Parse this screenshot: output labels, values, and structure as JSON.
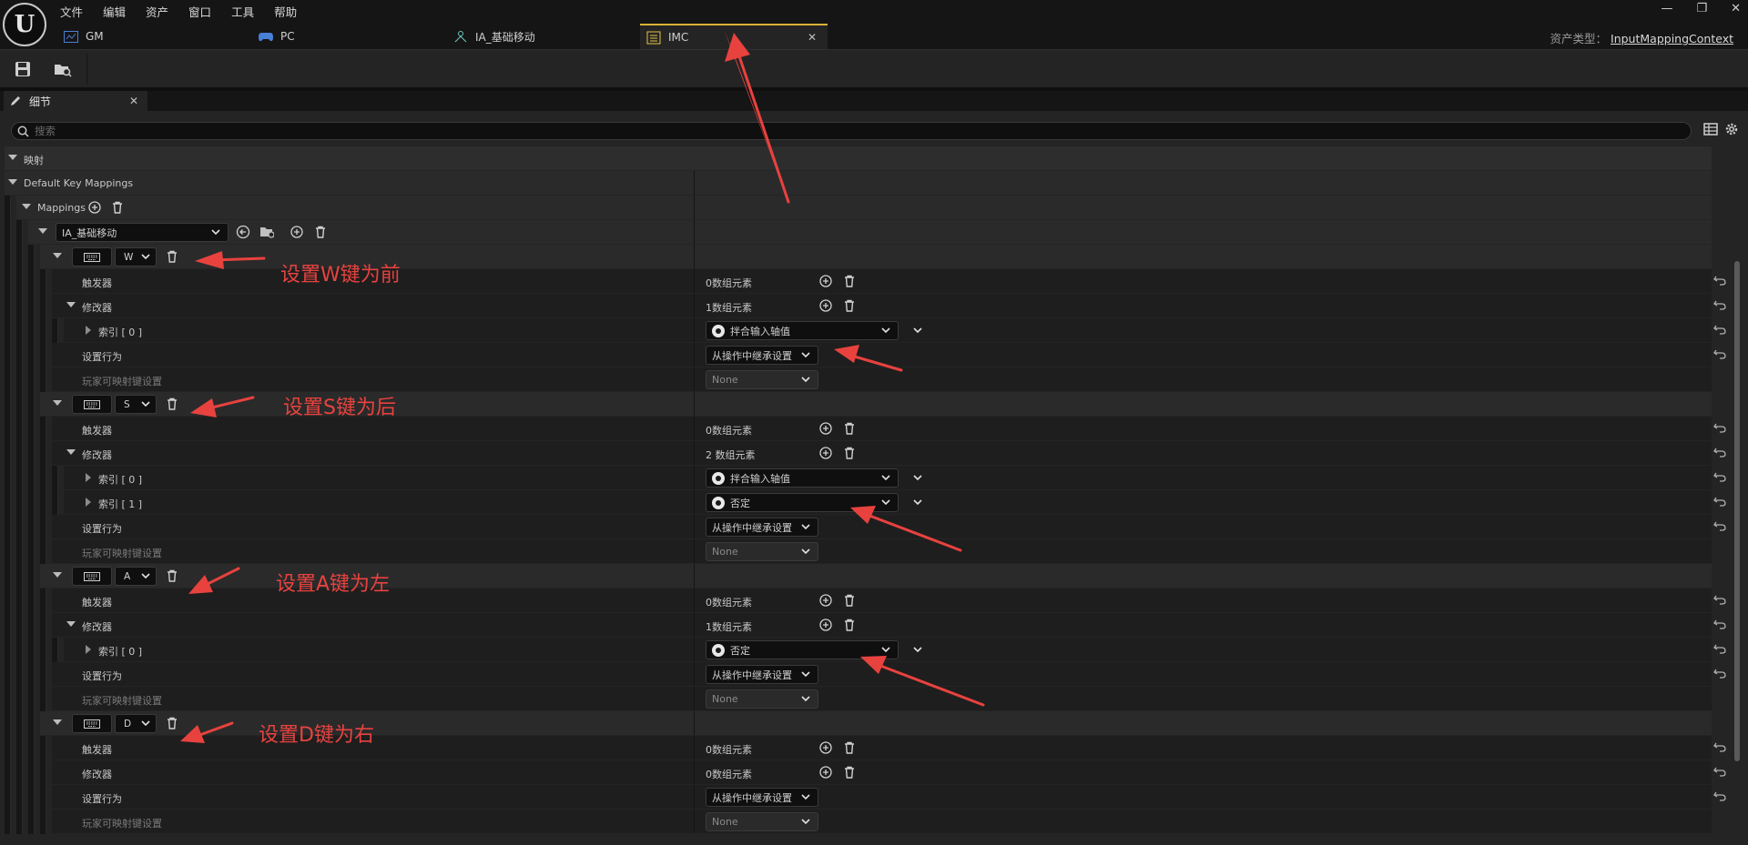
{
  "menu": [
    "文件",
    "编辑",
    "资产",
    "窗口",
    "工具",
    "帮助"
  ],
  "tabs": [
    {
      "label": "GM",
      "icon": "blueprint-icon"
    },
    {
      "label": "PC",
      "icon": "gamepad-icon"
    },
    {
      "label": "IA_基础移动",
      "icon": "input-action-icon"
    },
    {
      "label": "IMC",
      "icon": "input-mapping-context-icon",
      "active": true
    }
  ],
  "asset_type": {
    "label": "资产类型：",
    "value": "InputMappingContext"
  },
  "details": {
    "tab_label": "细节",
    "search_placeholder": "搜索"
  },
  "sections": {
    "mapping_category": "映射",
    "default_key_mappings": "Default Key Mappings",
    "mappings": "Mappings",
    "input_action": "IA_基础移动"
  },
  "keys": [
    {
      "key": "W",
      "trigger_label": "触发器",
      "trigger_value": "0数组元素",
      "modifier_label": "修改器",
      "modifier_value": "1数组元素",
      "modifiers": [
        {
          "index": "索引 [ 0 ]",
          "name": "拌合输入轴值"
        }
      ],
      "behavior_label": "设置行为",
      "behavior_value": "从操作中继承设置",
      "player_label": "玩家可映射键设置",
      "player_value": "None"
    },
    {
      "key": "S",
      "trigger_label": "触发器",
      "trigger_value": "0数组元素",
      "modifier_label": "修改器",
      "modifier_value": "2 数组元素",
      "modifiers": [
        {
          "index": "索引 [ 0 ]",
          "name": "拌合输入轴值"
        },
        {
          "index": "索引 [ 1 ]",
          "name": "否定"
        }
      ],
      "behavior_label": "设置行为",
      "behavior_value": "从操作中继承设置",
      "player_label": "玩家可映射键设置",
      "player_value": "None"
    },
    {
      "key": "A",
      "trigger_label": "触发器",
      "trigger_value": "0数组元素",
      "modifier_label": "修改器",
      "modifier_value": "1数组元素",
      "modifiers": [
        {
          "index": "索引 [ 0 ]",
          "name": "否定"
        }
      ],
      "behavior_label": "设置行为",
      "behavior_value": "从操作中继承设置",
      "player_label": "玩家可映射键设置",
      "player_value": "None"
    },
    {
      "key": "D",
      "trigger_label": "触发器",
      "trigger_value": "0数组元素",
      "modifier_label": "修改器",
      "modifier_value": "0数组元素",
      "modifiers": [],
      "behavior_label": "设置行为",
      "behavior_value": "从操作中继承设置",
      "player_label": "玩家可映射键设置",
      "player_value": "None"
    }
  ],
  "annotations": [
    "设置W键为前",
    "设置S键为后",
    "设置A键为左",
    "设置D键为右"
  ],
  "colors": {
    "annotation": "#e8423f",
    "active_tab_accent": "#d9b235",
    "panel_bg": "#242424"
  }
}
